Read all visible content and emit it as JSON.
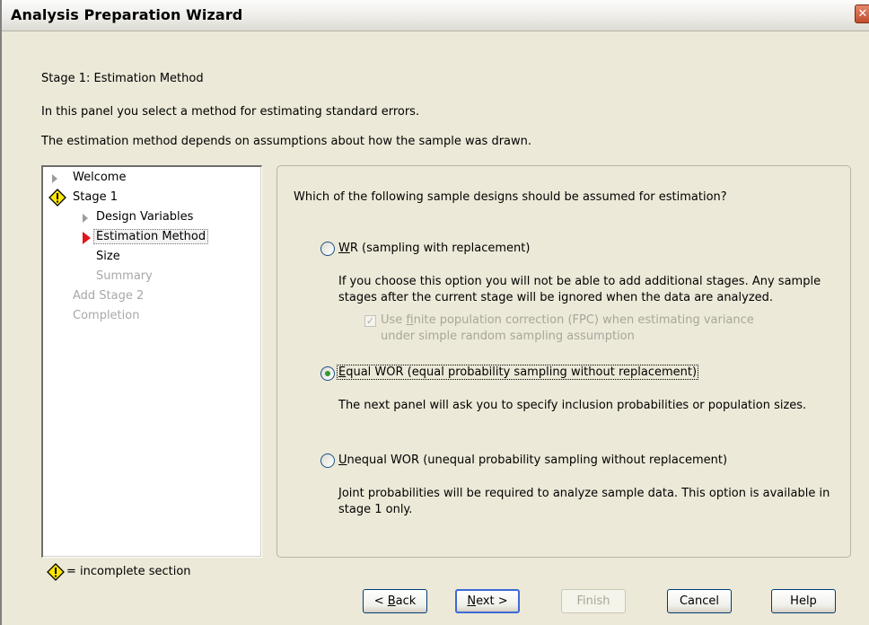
{
  "window": {
    "title": "Analysis Preparation Wizard",
    "close_glyph": "✕"
  },
  "header": {
    "stage": "Stage 1: Estimation Method",
    "line1": "In this panel you select a method for estimating standard errors.",
    "line2": "The estimation method depends on assumptions about how the sample was drawn."
  },
  "nav": {
    "welcome": "Welcome",
    "stage1": "Stage 1",
    "design_variables": "Design Variables",
    "estimation_method": "Estimation Method",
    "size": "Size",
    "summary": "Summary",
    "add_stage2": "Add Stage 2",
    "completion": "Completion"
  },
  "legend": {
    "text": "= incomplete section"
  },
  "main": {
    "question": "Which of the following sample designs should be assumed for estimation?",
    "options": [
      {
        "key": "W",
        "rest": "R (sampling with replacement)",
        "selected": false,
        "desc1": "If you choose this option you will not be able to add additional stages. Any sample",
        "desc2": "stages after the current stage will be ignored when the data are analyzed."
      },
      {
        "key": "E",
        "rest": "qual WOR (equal probability sampling without replacement)",
        "selected": true,
        "desc1": "The next panel will ask you to specify inclusion probabilities or population sizes."
      },
      {
        "key": "U",
        "rest": "nequal WOR (unequal probability sampling without replacement)",
        "selected": false,
        "desc1": "Joint probabilities will be required to analyze sample data.  This option is available in",
        "desc2": "stage 1 only."
      }
    ],
    "fpc": {
      "pre": "Use ",
      "key": "f",
      "rest": "inite population correction (FPC) when estimating variance",
      "line2": "under simple random sampling assumption",
      "checked": true,
      "enabled": false
    }
  },
  "buttons": {
    "back_pre": "< ",
    "back_key": "B",
    "back_rest": "ack",
    "next_key": "N",
    "next_rest": "ext >",
    "finish": "Finish",
    "cancel": "Cancel",
    "help": "Help"
  },
  "colors": {
    "accent_red": "#e0141b",
    "warn_yellow": "#ffe600",
    "radio_dot": "#2f9a2f"
  }
}
